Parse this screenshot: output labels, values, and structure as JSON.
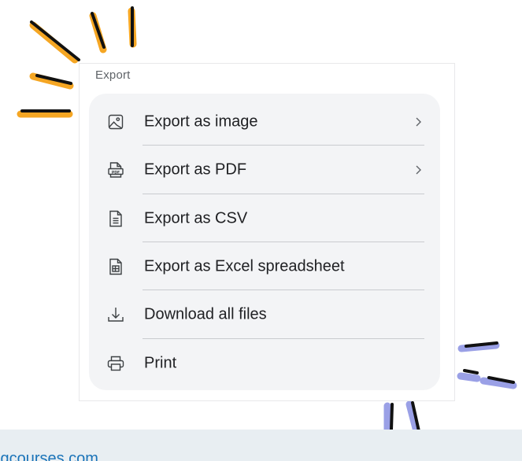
{
  "panel": {
    "title": "Export",
    "items": [
      {
        "label": "Export as image",
        "icon": "image-icon",
        "has_submenu": true
      },
      {
        "label": "Export as PDF",
        "icon": "pdf-file-icon",
        "has_submenu": true
      },
      {
        "label": "Export as CSV",
        "icon": "csv-file-icon",
        "has_submenu": false
      },
      {
        "label": "Export as Excel spreadsheet",
        "icon": "spreadsheet-file-icon",
        "has_submenu": false
      },
      {
        "label": "Download all files",
        "icon": "download-icon",
        "has_submenu": false
      },
      {
        "label": "Print",
        "icon": "printer-icon",
        "has_submenu": false
      }
    ]
  },
  "footer": {
    "text": "lgcourses.com"
  },
  "colors": {
    "burst_orange": "#f5a623",
    "burst_purple": "#9aa0e6",
    "ink": "#111111",
    "menu_background": "#f3f4f6",
    "footer_background": "#e8eef2",
    "footer_link": "#1a73b8"
  }
}
